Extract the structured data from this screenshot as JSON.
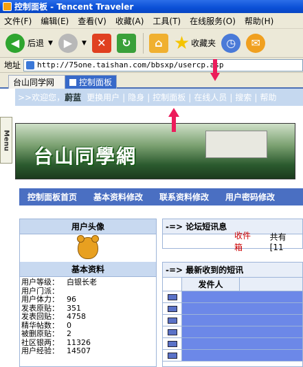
{
  "window": {
    "title": "控制面板 - Tencent Traveler"
  },
  "menu": [
    "文件(F)",
    "编辑(E)",
    "查看(V)",
    "收藏(A)",
    "工具(T)",
    "在线服务(O)",
    "帮助(H)"
  ],
  "toolbar": {
    "back_label": "后退",
    "favorites_label": "收藏夹"
  },
  "address": {
    "label": "地址",
    "url": "http://75one.taishan.com/bbsxp/usercp.asp"
  },
  "tabs": [
    {
      "label": "台山同学网"
    },
    {
      "label": "控制面板"
    }
  ],
  "nav": {
    "welcome": ">>欢迎您，",
    "username": "蔚蓝",
    "items": [
      "更换用户",
      "隐身",
      "控制面板",
      "在线人员",
      "搜索",
      "帮助"
    ]
  },
  "side": {
    "menu_label": "Menu"
  },
  "banner": {
    "title": "台山同學網"
  },
  "subnav": [
    "控制面板首页",
    "基本资料修改",
    "联系资料修改",
    "用户密码修改"
  ],
  "left": {
    "avatar_header": "用户头像",
    "basic_header": "基本资料",
    "fields": [
      {
        "k": "用户等级：",
        "v": "白银长老"
      },
      {
        "k": "用户门派：",
        "v": ""
      },
      {
        "k": "用户体力：",
        "v": "96"
      },
      {
        "k": "发表原贴：",
        "v": "351"
      },
      {
        "k": "发表回贴：",
        "v": "4758"
      },
      {
        "k": "精华帖数：",
        "v": "0"
      },
      {
        "k": "被删原贴：",
        "v": "2"
      },
      {
        "k": "社区银两：",
        "v": "11326"
      },
      {
        "k": "用户经验：",
        "v": "14507"
      }
    ]
  },
  "forum_msg": {
    "header": "-=> 论坛短讯息",
    "inbox": "收件箱",
    "total": "共有 [11"
  },
  "recent": {
    "header": "-=> 最新收到的短讯",
    "col_sender": "发件人"
  },
  "colors": {
    "arrow": "#ec1c5b",
    "nav_bg": "#c5d8ef",
    "subnav_bg": "#4a6fc2"
  }
}
